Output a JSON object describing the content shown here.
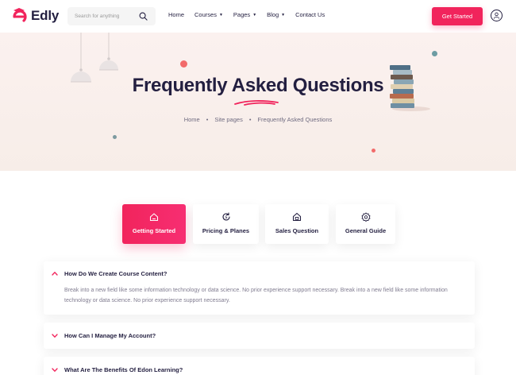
{
  "header": {
    "logo_text": "Edly",
    "search_placeholder": "Search for anything",
    "nav": [
      {
        "label": "Home",
        "has_caret": false
      },
      {
        "label": "Courses",
        "has_caret": true
      },
      {
        "label": "Pages",
        "has_caret": true
      },
      {
        "label": "Blog",
        "has_caret": true
      },
      {
        "label": "Contact Us",
        "has_caret": false
      }
    ],
    "cta_label": "Get Started"
  },
  "hero": {
    "title": "Frequently Asked Questions",
    "breadcrumb": [
      "Home",
      "Site pages",
      "Frequently Asked Questions"
    ]
  },
  "tabs": [
    {
      "label": "Getting Started",
      "icon": "home-icon",
      "active": true
    },
    {
      "label": "Pricing & Planes",
      "icon": "refresh-dollar-icon",
      "active": false
    },
    {
      "label": "Sales Question",
      "icon": "lock-house-icon",
      "active": false
    },
    {
      "label": "General Guide",
      "icon": "gear-icon",
      "active": false
    }
  ],
  "faq": [
    {
      "question": "How Do We Create Course Content?",
      "open": true,
      "answer": "Break into a new field like some information technology or data science. No prior experience support necessary. Break into a new field like some information technology or data science. No prior experience support necessary."
    },
    {
      "question": "How Can I Manage My Account?",
      "open": false
    },
    {
      "question": "What Are The Benefits Of Edon Learning?",
      "open": false
    }
  ],
  "colors": {
    "accent": "#f1245c",
    "heading": "#231f40",
    "body_text": "#807c90",
    "hero_bg": "#fbf1ef"
  }
}
